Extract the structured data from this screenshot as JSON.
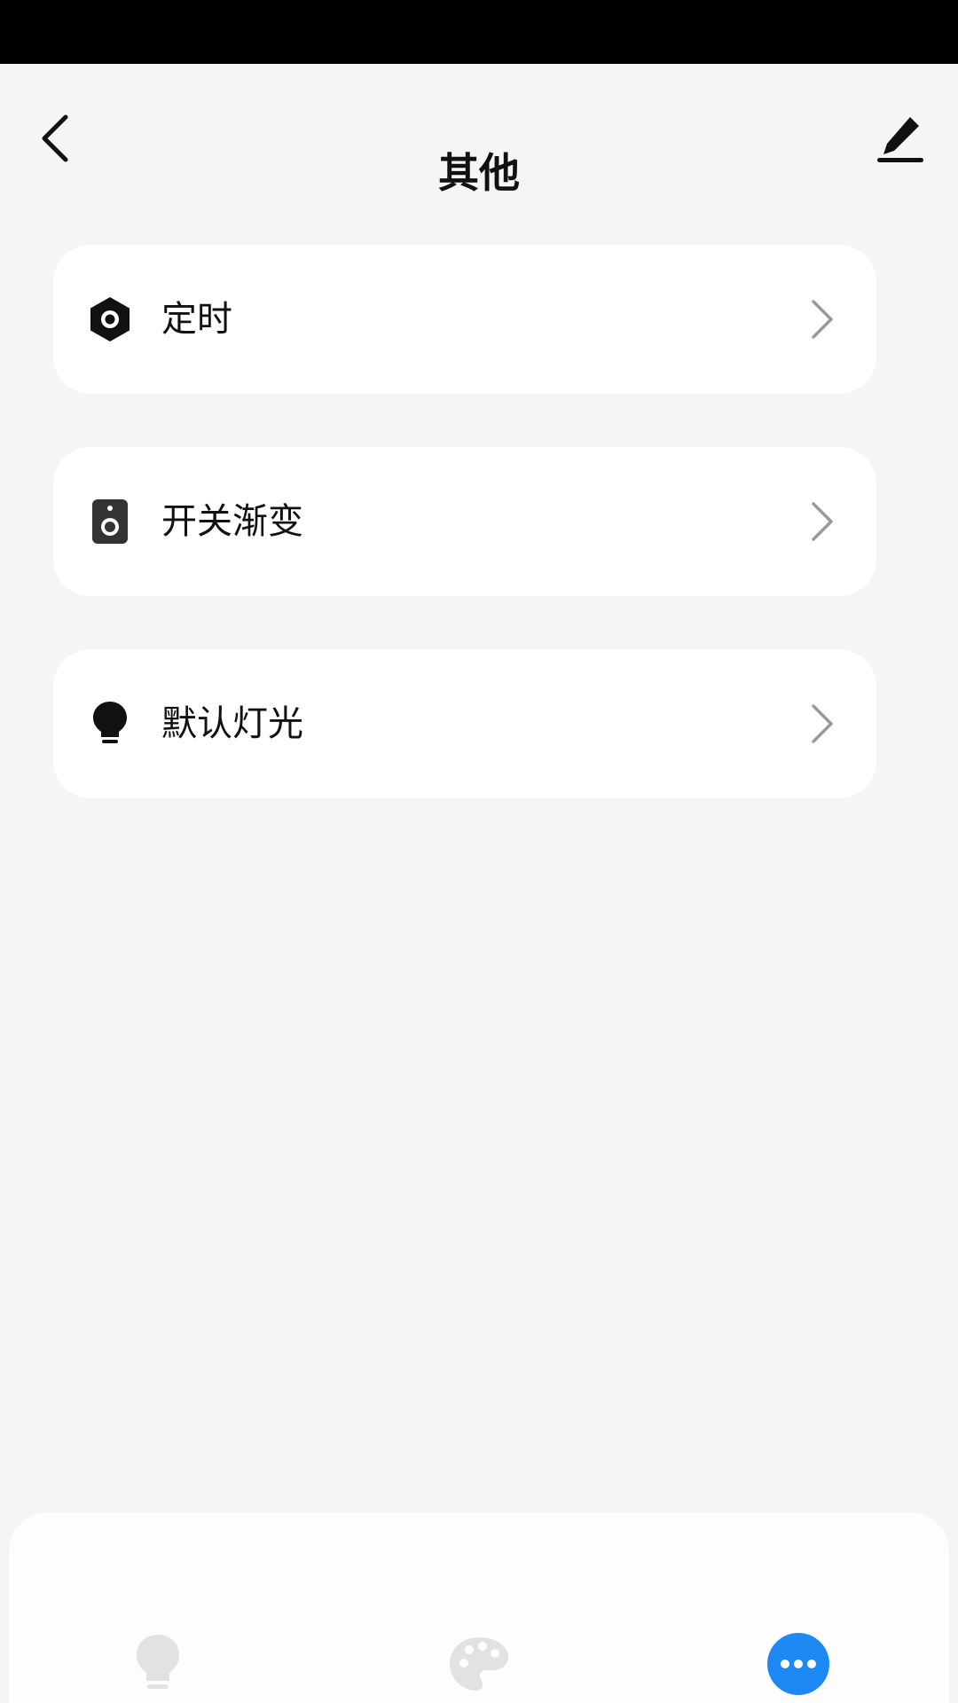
{
  "header": {
    "title": "其他",
    "back_icon": "chevron-left-icon",
    "edit_icon": "pencil-icon"
  },
  "menu": {
    "items": [
      {
        "label": "定时",
        "icon": "hexagon-nut-icon"
      },
      {
        "label": "开关渐变",
        "icon": "speaker-icon"
      },
      {
        "label": "默认灯光",
        "icon": "lightbulb-icon"
      }
    ],
    "chevron_icon": "chevron-right-icon"
  },
  "tabbar": {
    "tabs": [
      {
        "icon": "lightbulb-icon",
        "active": false
      },
      {
        "icon": "palette-icon",
        "active": false
      },
      {
        "icon": "more-dots-icon",
        "active": true
      }
    ]
  },
  "colors": {
    "background": "#f5f5f5",
    "card": "#ffffff",
    "text": "#111111",
    "chevron": "#9a9a9a",
    "tab_inactive": "#e2e2e2",
    "tab_active": "#1e88f5"
  }
}
